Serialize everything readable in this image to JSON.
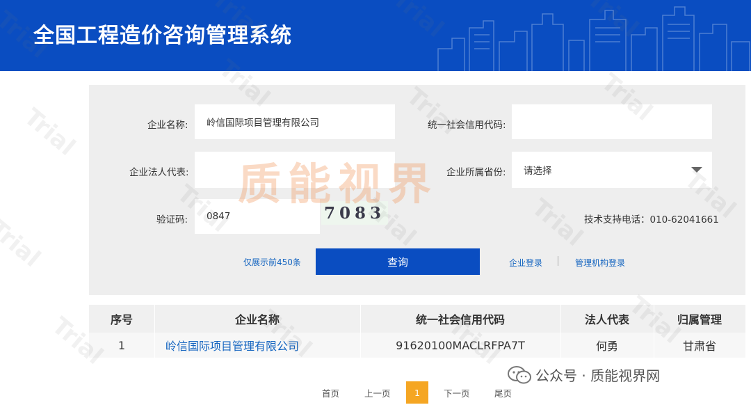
{
  "header": {
    "title": "全国工程造价咨询管理系统"
  },
  "form": {
    "company_name_label": "企业名称:",
    "company_name_value": "岭信国际项目管理有限公司",
    "credit_code_label": "统一社会信用代码:",
    "credit_code_value": "",
    "legal_rep_label": "企业法人代表:",
    "legal_rep_value": "",
    "province_label": "企业所属省份:",
    "province_value": "请选择",
    "captcha_label": "验证码:",
    "captcha_value": "0847",
    "captcha_image_text": "7083",
    "support_phone": "技术支持电话：010-62041661",
    "limit_note": "仅展示前450条",
    "query_button": "查询",
    "company_login": "企业登录",
    "agency_login": "管理机构登录"
  },
  "table": {
    "headers": [
      "序号",
      "企业名称",
      "统一社会信用代码",
      "法人代表",
      "归属管理"
    ],
    "rows": [
      [
        "1",
        "岭信国际项目管理有限公司",
        "91620100MACLRFPA7T",
        "何勇",
        "甘肃省"
      ]
    ]
  },
  "pagination": {
    "first": "首页",
    "prev": "上一页",
    "current": "1",
    "next": "下一页",
    "last": "尾页"
  },
  "watermarks": {
    "trial": "Trial",
    "brand": "质能视界",
    "wechat": "公众号 · 质能视界网"
  },
  "colors": {
    "header_blue": "#0a4dc1",
    "link_blue": "#1565c0",
    "page_current": "#f5a623",
    "brand_watermark": "#f0965a"
  }
}
